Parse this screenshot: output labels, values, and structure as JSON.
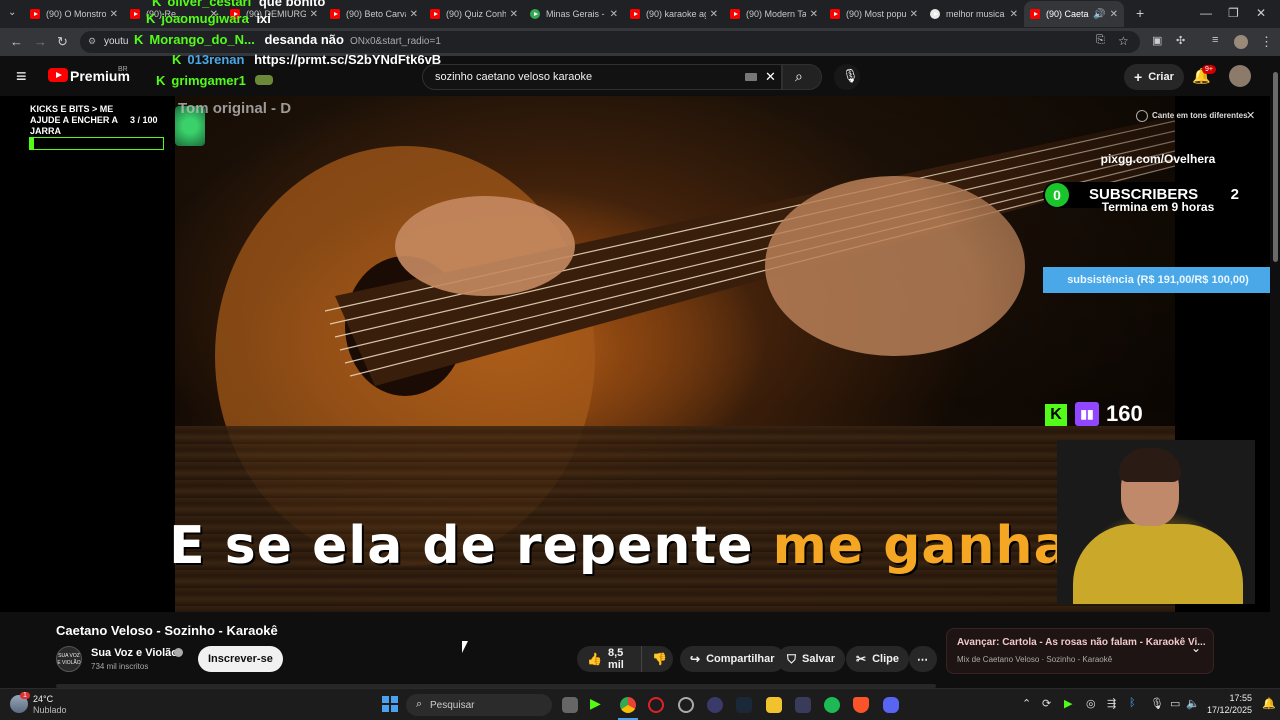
{
  "tabs": [
    {
      "label": "(90) O Monstro",
      "icon": "youtube-icon"
    },
    {
      "label": "(90) Re...",
      "icon": "youtube-icon"
    },
    {
      "label": "(90) DEMIURG",
      "icon": "youtube-icon"
    },
    {
      "label": "(90) Beto Carva",
      "icon": "youtube-icon"
    },
    {
      "label": "(90) Quiz Conh",
      "icon": "youtube-icon"
    },
    {
      "label": "Minas Gerais -",
      "icon": "maps-icon"
    },
    {
      "label": "(90) karaoke ag",
      "icon": "youtube-icon"
    },
    {
      "label": "(90) Modern Ta",
      "icon": "youtube-icon"
    },
    {
      "label": "(90) Most popu",
      "icon": "youtube-icon"
    },
    {
      "label": "melhor musica",
      "icon": "google-icon"
    },
    {
      "label": "(90) Caeta",
      "icon": "youtube-icon"
    }
  ],
  "address": {
    "url": "youtu",
    "url_tail": "ONx0&start_radio=1"
  },
  "youtube": {
    "logo": "Premium",
    "region": "BR",
    "search_value": "sozinho caetano veloso karaoke",
    "create_label": "Criar",
    "notif_badge": "9+"
  },
  "chat": [
    {
      "user": "oliver_cestari",
      "msg": "que bonito",
      "user_color": "#53fc18"
    },
    {
      "user": "joaomugiwara",
      "msg": "ixi",
      "user_color": "#53fc18"
    },
    {
      "user": "Morango_do_N...",
      "msg": "desanda não",
      "user_color": "#53fc18"
    },
    {
      "user": "013renan",
      "msg": "https://prmt.sc/S2bYNdFtk6vB",
      "user_color": "#4aa8e8"
    },
    {
      "user": "grimgamer1",
      "msg": "",
      "user_color": "#53fc18"
    }
  ],
  "overlay": {
    "kicks_title": "KICKS E BITS > ME AJUDE A ENCHER A JARRA",
    "kicks_progress": "3 / 100",
    "kicks_fraction": 0.03,
    "tom_original": "Tom original - D",
    "subscribers_label": "SUBSCRIBERS",
    "subscribers_left": "0",
    "subscribers_right": "2",
    "cante_label": "Cante em tons diferentes",
    "pix": "pixgg.com/Ovelhera",
    "goal": "subsistência (R$ 191,00/R$ 100,00)",
    "goal_end": "Termina em 9 horas",
    "viewers": "160"
  },
  "lyric": {
    "white": "E se ela de repente",
    "yellow": "me ganha?"
  },
  "video": {
    "title": "Caetano Veloso - Sozinho - Karaokê",
    "channel": "Sua Voz e Violão",
    "channel_avatar_text": "SUA VOZ E VIOLÃO",
    "subscribers": "734 mil inscritos",
    "subscribe_label": "Inscrever-se",
    "likes": "8,5 mil",
    "share_label": "Compartilhar",
    "save_label": "Salvar",
    "clip_label": "Clipe",
    "next_title": "Avançar: Cartola - As rosas não falam - Karaokê Vi...",
    "next_sub": "Mix de Caetano Veloso · Sozinho - Karaokê"
  },
  "taskbar": {
    "temp": "24°C",
    "weather": "Nublado",
    "weather_badge": "1",
    "search_placeholder": "Pesquisar",
    "time": "17:55",
    "date": "17/12/2025"
  }
}
